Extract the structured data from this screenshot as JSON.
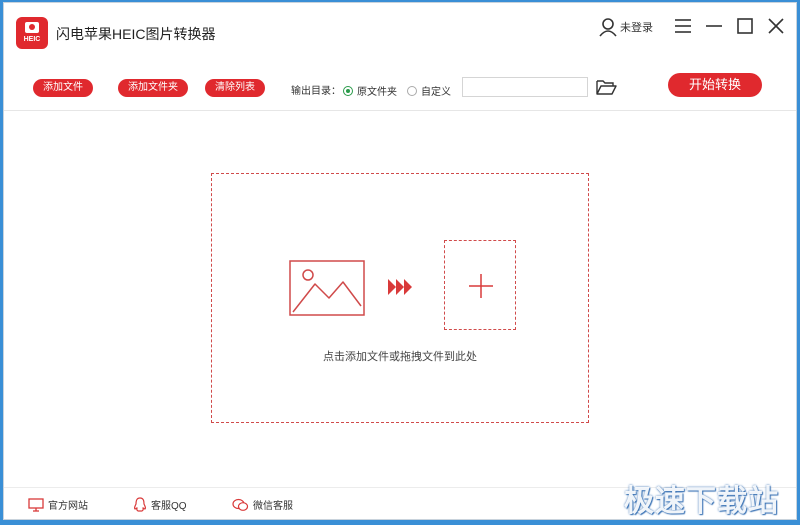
{
  "app": {
    "title": "闪电苹果HEIC图片转换器",
    "logo_text": "HEIC"
  },
  "user": {
    "label": "未登录"
  },
  "toolbar": {
    "add_file": "添加文件",
    "add_folder": "添加文件夹",
    "clear_list": "清除列表",
    "output_label": "输出目录：",
    "radio_original": "原文件夹",
    "radio_custom": "自定义",
    "path_value": "",
    "start": "开始转换"
  },
  "dropzone": {
    "hint": "点击添加文件或拖拽文件到此处"
  },
  "footer": {
    "website": "官方网站",
    "qq": "客服QQ",
    "wechat": "微信客服"
  },
  "watermark": "极速下载站",
  "colors": {
    "accent": "#e0292e",
    "radio_on": "#2a9a4a",
    "desktop": "#3a8fd6"
  }
}
